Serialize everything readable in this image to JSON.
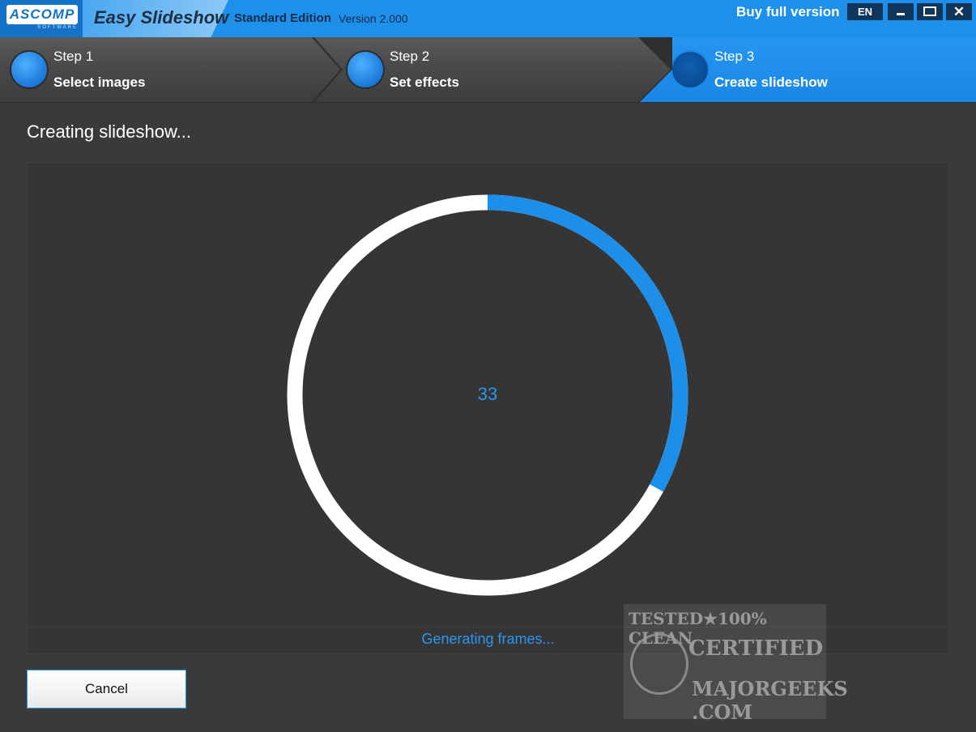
{
  "titlebar": {
    "logo": "ASCOMP",
    "logo_sub": "SOFTWARE",
    "app_name": "Easy Slideshow",
    "edition": "Standard Edition",
    "version": "Version 2.000",
    "buy_label": "Buy full version",
    "language": "EN"
  },
  "steps": [
    {
      "number": "Step 1",
      "label": "Select images",
      "active": false
    },
    {
      "number": "Step 2",
      "label": "Set effects",
      "active": false
    },
    {
      "number": "Step 3",
      "label": "Create slideshow",
      "active": true
    }
  ],
  "main": {
    "heading": "Creating slideshow...",
    "progress_percent": 33,
    "progress_text": "33",
    "status": "Generating frames...",
    "cancel_label": "Cancel"
  },
  "watermark": {
    "line1": "TESTED★100% CLEAN",
    "line2": "CERTIFIED",
    "line3": "MAJORGEEKS .COM"
  },
  "colors": {
    "accent": "#1e90ea",
    "progress_fill": "#1e8fe8",
    "progress_track": "#ffffff",
    "background": "#3a3a3a"
  }
}
